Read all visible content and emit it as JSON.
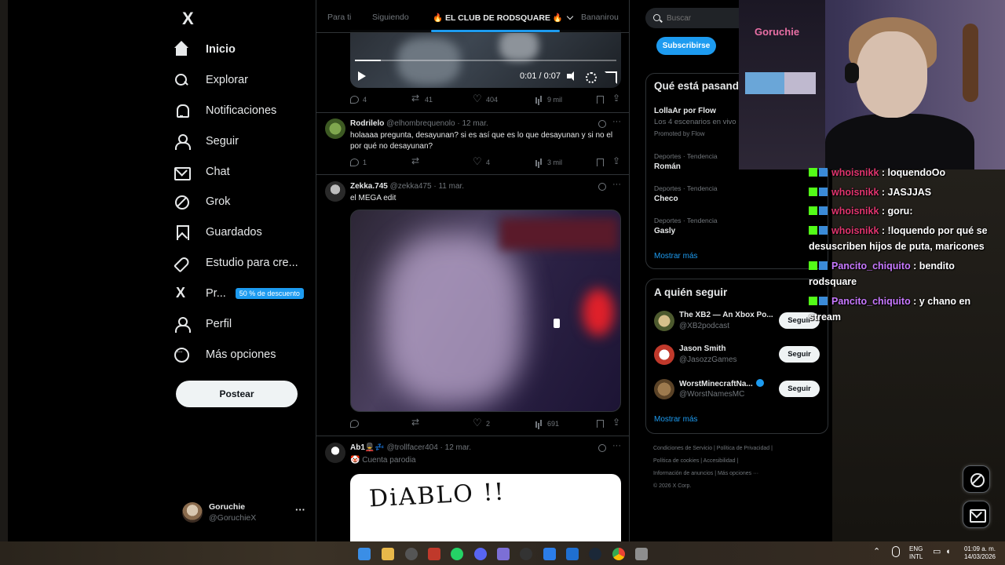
{
  "nav": {
    "items": [
      {
        "label": "Inicio",
        "icon": "home-icon"
      },
      {
        "label": "Explorar",
        "icon": "search-icon"
      },
      {
        "label": "Notificaciones",
        "icon": "bell-icon"
      },
      {
        "label": "Seguir",
        "icon": "follow-icon"
      },
      {
        "label": "Chat",
        "icon": "mail-icon"
      },
      {
        "label": "Grok",
        "icon": "grok-icon"
      },
      {
        "label": "Guardados",
        "icon": "bookmark-icon"
      },
      {
        "label": "Estudio para cre...",
        "icon": "rocket-icon"
      },
      {
        "label": "Pr...",
        "icon": "x-icon",
        "badge": "50 % de descuento"
      },
      {
        "label": "Perfil",
        "icon": "person-icon"
      },
      {
        "label": "Más opciones",
        "icon": "more-icon"
      }
    ],
    "post_button": "Postear",
    "account": {
      "name": "Goruchie",
      "handle": "@GoruchieX"
    }
  },
  "tabs": [
    "Para ti",
    "Siguiendo",
    "🔥 EL CLUB DE RODSQUARE 🔥",
    "Bananirou"
  ],
  "feed": {
    "video1": {
      "time": "0:01 / 0:07",
      "progress": 0.1
    },
    "post0_actions": {
      "replies": "4",
      "reposts": "41",
      "likes": "404",
      "views": "9 mil"
    },
    "posts": [
      {
        "name": "Rodrilelo",
        "handle": "@elhombrequenolo",
        "date": "· 12 mar.",
        "text": "holaaaa pregunta, desayunan? si es así que es lo que desayunan y si no el por qué no desayunan?",
        "replies": "1",
        "reposts": "",
        "likes": "4",
        "views": "3 mil"
      },
      {
        "name": "Zekka.745",
        "handle": "@zekka475",
        "date": "· 11 mar.",
        "text": "el MEGA edit",
        "replies": "",
        "reposts": "",
        "likes": "2",
        "views": "691"
      },
      {
        "name": "Ab1💂‍♂️💤",
        "handle": "@trollfacer404",
        "date": "· 12 mar.",
        "text": "🤡 Cuenta parodia",
        "image_text": "DiABLO !!"
      }
    ]
  },
  "right": {
    "search_placeholder": "Buscar",
    "subscribe": "Subscribirse",
    "trends_title": "Qué está pasando",
    "trends": [
      {
        "name": "LollaAr por Flow",
        "sub": "Los 4 escenarios en vivo",
        "promoted": "Promoted by Flow"
      },
      {
        "cat": "Deportes · Tendencia",
        "name": "Román"
      },
      {
        "cat": "Deportes · Tendencia",
        "name": "Checo"
      },
      {
        "cat": "Deportes · Tendencia",
        "name": "Gasly"
      }
    ],
    "show_more": "Mostrar más",
    "who_title": "A quién seguir",
    "who": [
      {
        "name": "The XB2 — An Xbox Po...",
        "handle": "@XB2podcast",
        "button": "Seguir"
      },
      {
        "name": "Jason Smith",
        "handle": "@JasozzGames",
        "button": "Seguir"
      },
      {
        "name": "WorstMinecraftNa...",
        "handle": "@WorstNamesMC",
        "button": "Seguir",
        "verified": true
      }
    ],
    "who_more": "Mostrar más",
    "footer": {
      "line1": "Condiciones de Servicio  |  Política de Privacidad  |",
      "line2": "Política de cookies  |  Accesibilidad  |",
      "line3": "Información de anuncios  |  Más opciones ···",
      "line4": "© 2026 X Corp."
    }
  },
  "cam": {
    "neon_sign": "Goruchie"
  },
  "chat": [
    {
      "user": "whoisnikk",
      "text": " : loquendoOo",
      "color": "#e0356e"
    },
    {
      "user": "whoisnikk",
      "text": " : JASJJAS",
      "color": "#e0356e"
    },
    {
      "user": "whoisnikk",
      "text": " : goru:",
      "color": "#e0356e"
    },
    {
      "user": "whoisnikk",
      "text": " : !loquendo por qué se desuscriben hijos de puta, maricones",
      "color": "#e0356e"
    },
    {
      "user": "Pancito_chiquito",
      "text": " : bendito rodsquare",
      "color": "#c879ff"
    },
    {
      "user": "Pancito_chiquito",
      "text": " : y chano en stream",
      "color": "#c879ff"
    }
  ],
  "taskbar": {
    "lang": "ENG",
    "layout": "INTL",
    "time": "01:09 a. m.",
    "date": "14/03/2026"
  },
  "colors": {
    "accent": "#1d9bf0",
    "background": "#000000",
    "text": "#e7e9ea",
    "muted": "#71767b"
  }
}
